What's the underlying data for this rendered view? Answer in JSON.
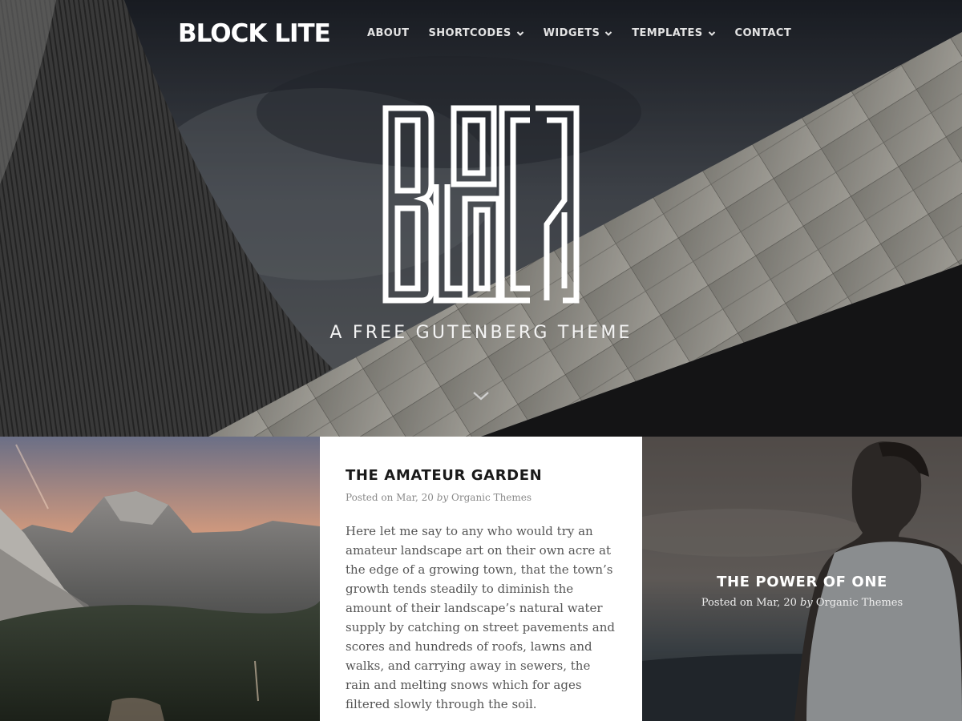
{
  "site": {
    "title": "BLOCK LITE",
    "tagline": "A FREE GUTENBERG THEME",
    "hero_mark": "BLOCK"
  },
  "nav": [
    {
      "label": "ABOUT",
      "has_dropdown": false
    },
    {
      "label": "SHORTCODES",
      "has_dropdown": true
    },
    {
      "label": "WIDGETS",
      "has_dropdown": true
    },
    {
      "label": "TEMPLATES",
      "has_dropdown": true
    },
    {
      "label": "CONTACT",
      "has_dropdown": false
    }
  ],
  "icons": {
    "dropdown": "chevron-down-icon",
    "scroll": "chevron-down-icon"
  },
  "posts": [
    {
      "title": "THE AMATEUR GARDEN",
      "meta_prefix": "Posted on Mar, 20",
      "meta_by": "by",
      "author": "Organic Themes",
      "excerpt": "Here let me say to any who would try an amateur landscape art on their own acre at the edge of a growing town, that the town’s growth tends steadily to diminish the amount of their landscape’s natural water supply by catching on street pavements and scores and hundreds of roofs, lawns and walks, and carrying away in sewers, the rain and melting snows which for ages filtered slowly through the soil."
    },
    {
      "title": "THE POWER OF ONE",
      "meta_prefix": "Posted on Mar, 20",
      "meta_by": "by",
      "author": "Organic Themes"
    }
  ],
  "colors": {
    "text_dark": "#1a1a1a",
    "meta_gray": "#8a8a8a",
    "body_gray": "#555555",
    "white": "#ffffff"
  }
}
